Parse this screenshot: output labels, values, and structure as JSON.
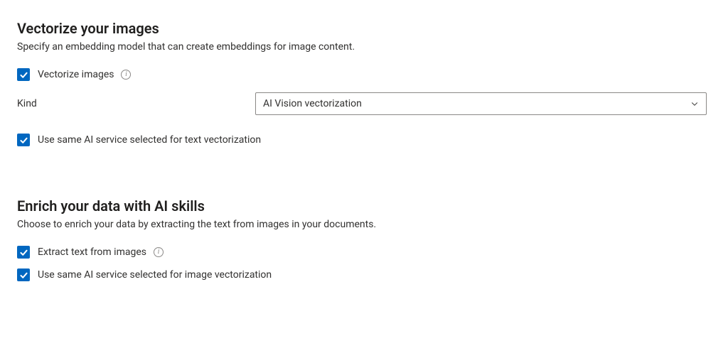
{
  "section1": {
    "title": "Vectorize your images",
    "desc": "Specify an embedding model that can create embeddings for image content.",
    "checkbox_vectorize": "Vectorize images",
    "field_kind_label": "Kind",
    "field_kind_value": "AI Vision vectorization",
    "checkbox_same_service": "Use same AI service selected for text vectorization"
  },
  "section2": {
    "title": "Enrich your data with AI skills",
    "desc": "Choose to enrich your data by extracting the text from images in your documents.",
    "checkbox_extract": "Extract text from images",
    "checkbox_same_service": "Use same AI service selected for image vectorization"
  }
}
